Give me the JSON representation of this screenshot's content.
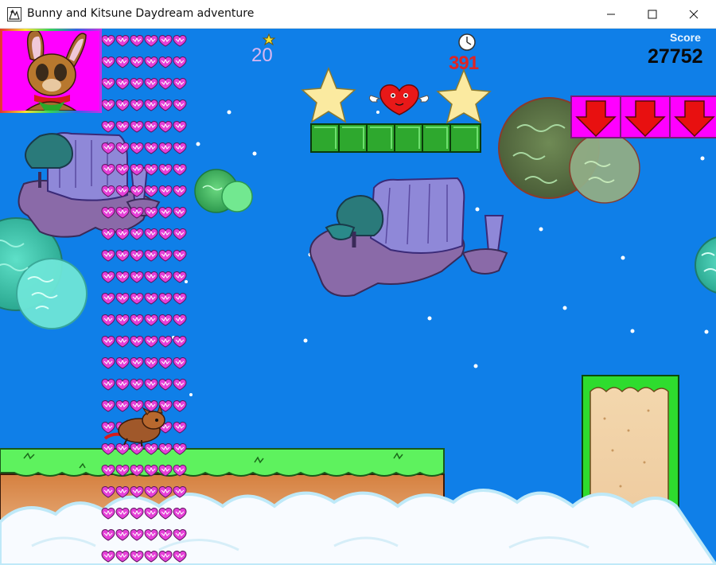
{
  "window": {
    "title": "Bunny and Kitsune Daydream adventure",
    "controls": [
      "minimize",
      "maximize",
      "close"
    ]
  },
  "hud": {
    "star_count": "20",
    "time_remaining": "391",
    "score_label": "Score",
    "score_value": "27752"
  },
  "icons": {
    "star": "star-icon",
    "clock": "clock-icon",
    "heart": "winged-heart-icon",
    "arrow": "down-arrow-icon"
  },
  "colors": {
    "sky": "#0f7fe8",
    "heart_column": "#e640d8",
    "grass": "#5ef25e",
    "dirt": "#d9884a",
    "sand": "#f0d0a0",
    "arrow_block": "#ff00ff",
    "arrow": "#e81010",
    "block": "#2ea82e",
    "star_fill": "#fbeaa0"
  }
}
